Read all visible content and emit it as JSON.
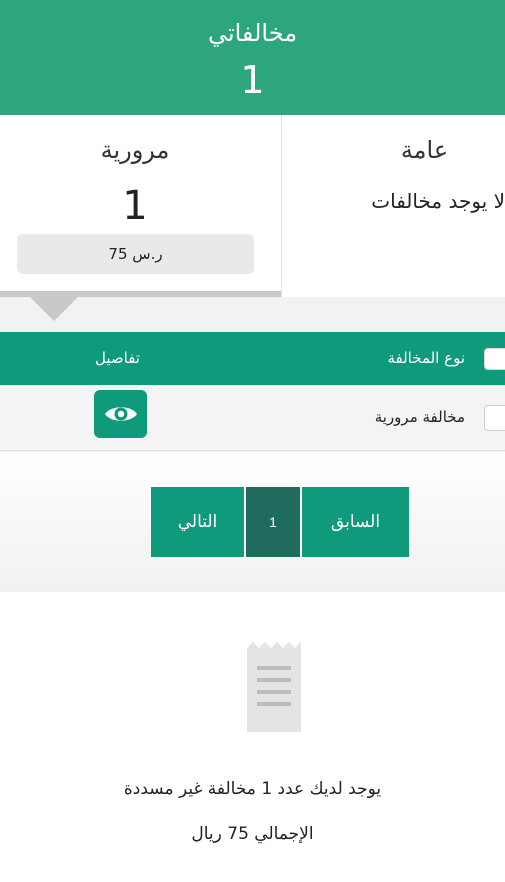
{
  "header": {
    "title": "مخالفاتي",
    "count": "1",
    "background_color": "#2ea67b"
  },
  "cards": {
    "traffic": {
      "title": "مرورية",
      "count": "1",
      "amount": "75 ر.س",
      "selected": true
    },
    "general": {
      "title": "عامة",
      "message": "لا يوجد مخالفات"
    }
  },
  "table": {
    "headers": {
      "type": "نوع المخالفة",
      "details": "تفاصيل"
    },
    "rows": [
      {
        "type": "مخالفة مرورية",
        "details_icon": "eye-icon"
      }
    ],
    "header_color": "#109a7c"
  },
  "pagination": {
    "next_label": "التالي",
    "current_page": "1",
    "prev_label": "السابق"
  },
  "summary": {
    "icon": "receipt-icon",
    "line1": "يوجد لديك عدد  1 مخالفة غير مسددة",
    "line2": "الإجمالي 75 ريال"
  }
}
